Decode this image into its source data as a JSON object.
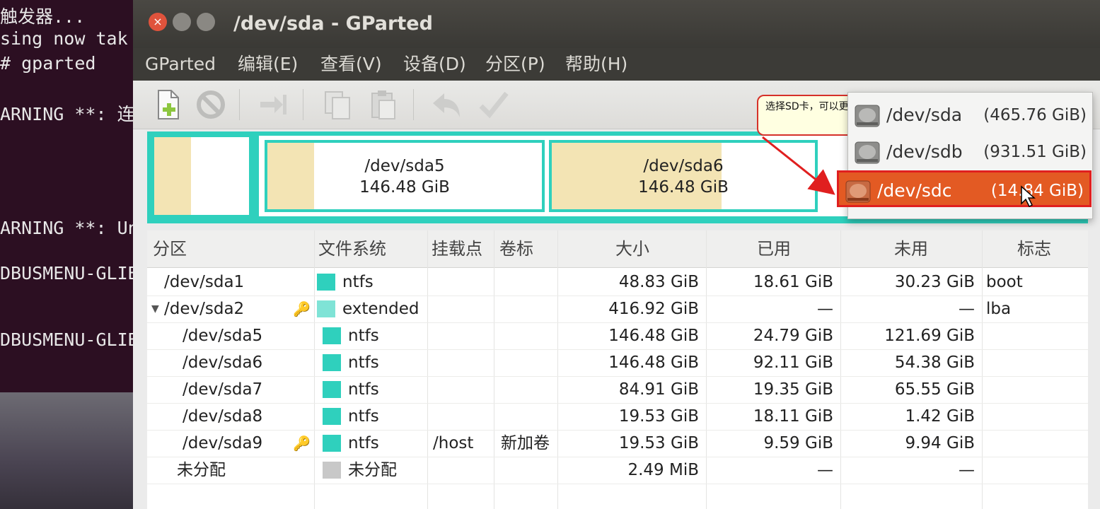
{
  "terminal": {
    "lines": [
      "触发器...",
      "sing now tak",
      "# gparted",
      "ARNING **: 连",
      "ARNING **: Un",
      "DBUSMENU-GLIB-",
      "DBUSMENU-GLIB-"
    ]
  },
  "window": {
    "title": "/dev/sda - GParted"
  },
  "menu": [
    "GParted",
    "编辑(E)",
    "查看(V)",
    "设备(D)",
    "分区(P)",
    "帮助(H)"
  ],
  "graph": {
    "parts": [
      {
        "name": "/dev/sda5",
        "size": "146.48 GiB"
      },
      {
        "name": "/dev/sda6",
        "size": "146.48 GiB"
      }
    ]
  },
  "callout": {
    "text": "选择SD卡，可以更加容量来选择"
  },
  "devices": [
    {
      "name": "/dev/sda",
      "size": "(465.76 GiB)"
    },
    {
      "name": "/dev/sdb",
      "size": "(931.51 GiB)"
    },
    {
      "name": "/dev/sdc",
      "size": "(14.84 GiB)"
    }
  ],
  "table": {
    "headers": [
      "分区",
      "文件系统",
      "挂载点",
      "卷标",
      "大小",
      "已用",
      "未用",
      "标志"
    ],
    "rows": [
      {
        "part": "/dev/sda1",
        "fs": "ntfs",
        "mount": "",
        "label": "",
        "size": "48.83 GiB",
        "used": "18.61 GiB",
        "free": "30.23 GiB",
        "flags": "boot"
      },
      {
        "part": "/dev/sda2",
        "fs": "extended",
        "mount": "",
        "label": "",
        "size": "416.92 GiB",
        "used": "—",
        "free": "—",
        "flags": "lba"
      },
      {
        "part": "/dev/sda5",
        "fs": "ntfs",
        "mount": "",
        "label": "",
        "size": "146.48 GiB",
        "used": "24.79 GiB",
        "free": "121.69 GiB",
        "flags": ""
      },
      {
        "part": "/dev/sda6",
        "fs": "ntfs",
        "mount": "",
        "label": "",
        "size": "146.48 GiB",
        "used": "92.11 GiB",
        "free": "54.38 GiB",
        "flags": ""
      },
      {
        "part": "/dev/sda7",
        "fs": "ntfs",
        "mount": "",
        "label": "",
        "size": "84.91 GiB",
        "used": "19.35 GiB",
        "free": "65.55 GiB",
        "flags": ""
      },
      {
        "part": "/dev/sda8",
        "fs": "ntfs",
        "mount": "",
        "label": "",
        "size": "19.53 GiB",
        "used": "18.11 GiB",
        "free": "1.42 GiB",
        "flags": ""
      },
      {
        "part": "/dev/sda9",
        "fs": "ntfs",
        "mount": "/host",
        "label": "新加卷",
        "size": "19.53 GiB",
        "used": "9.59 GiB",
        "free": "9.94 GiB",
        "flags": ""
      },
      {
        "part": "未分配",
        "fs": "未分配",
        "mount": "",
        "label": "",
        "size": "2.49 MiB",
        "used": "—",
        "free": "—",
        "flags": ""
      }
    ]
  },
  "icons": {
    "toolbar": [
      "new-icon",
      "delete-icon",
      "resize-icon",
      "copy-icon",
      "paste-icon",
      "undo-icon",
      "apply-icon"
    ],
    "key": "key-icon",
    "disk": "harddisk-icon",
    "expander": "expander-icon"
  },
  "colors": {
    "ntfs": "#2fd0bd",
    "extended": "#7fe3d6",
    "unallocated": "#c8c8c8",
    "selection": "#e35a23",
    "accent": "#e01f1f"
  }
}
